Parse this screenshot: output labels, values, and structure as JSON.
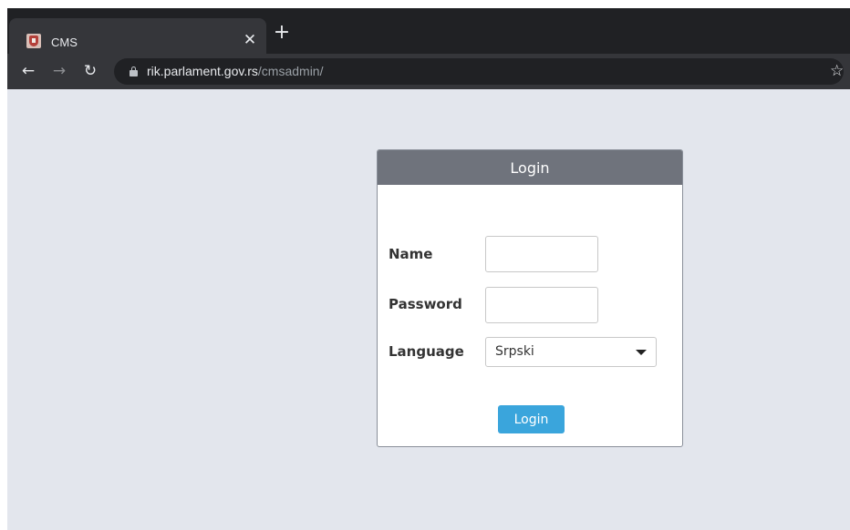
{
  "browser": {
    "tab": {
      "title": "CMS",
      "close_icon": "close-icon",
      "favicon": "serbia-coat-of-arms-icon"
    },
    "new_tab_icon": "plus-icon",
    "nav": {
      "back_icon": "arrow-left-icon",
      "forward_icon": "arrow-right-icon",
      "reload_icon": "reload-icon"
    },
    "address": {
      "host": "rik.parlament.gov.rs",
      "path": "/cmsadmin/",
      "lock_icon": "lock-icon",
      "bookmark_icon": "star-icon"
    }
  },
  "login": {
    "title": "Login",
    "name_label": "Name",
    "name_value": "",
    "password_label": "Password",
    "password_value": "",
    "language_label": "Language",
    "language_selected": "Srpski",
    "submit_label": "Login"
  },
  "colors": {
    "tab_strip": "#202124",
    "toolbar": "#35363a",
    "page_background": "#e3e6ed",
    "panel_header": "#6f737c",
    "login_button": "#3aa5dc"
  }
}
